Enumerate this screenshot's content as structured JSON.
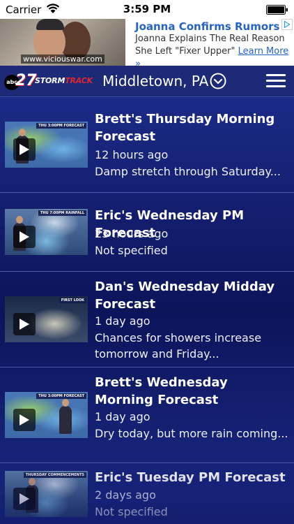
{
  "status_bar": {
    "carrier": "Carrier",
    "time": "3:59 PM"
  },
  "ad": {
    "url": "www.viciouswar.com",
    "headline": "Joanna Confirms Rumors",
    "body_line1": "Joanna Explains The Real Reason",
    "body_line2": "She Left \"Fixer Upper\"",
    "learn_more": "Learn More »"
  },
  "header": {
    "logo_abc": "abc",
    "logo_number": "27",
    "logo_storm": "STORM",
    "logo_track": "TRACK",
    "location": "Middletown, PA"
  },
  "videos": [
    {
      "title": "Brett's Thursday Morning Forecast",
      "time": "12 hours ago",
      "description": "Damp stretch through Saturday...",
      "thumb_label": "THU 3:00PM FORECAST"
    },
    {
      "title": "Eric's Wednesday PM Forecast",
      "time": "23 hours ago",
      "description": "Not specified",
      "thumb_label": "THU 7:00PM RAINFALL"
    },
    {
      "title": "Dan's Wednesday Midday Forecast",
      "time": "1 day ago",
      "description": "Chances for showers increase tomorrow and Friday...",
      "thumb_label": "FIRST LOOK"
    },
    {
      "title": "Brett's Wednesday Morning Forecast",
      "time": "1 day ago",
      "description": "Dry today, but more rain coming...",
      "thumb_label": "THU 3:00PM FORECAST"
    },
    {
      "title": "Eric's Tuesday PM Forecast",
      "time": "2 days ago",
      "description": "Not specified",
      "thumb_label": "THURSDAY COMMENCEMENTS"
    }
  ],
  "colors": {
    "header_bg": "#1c2a78",
    "list_bg": "#141e5c",
    "ad_link": "#2563c7"
  }
}
